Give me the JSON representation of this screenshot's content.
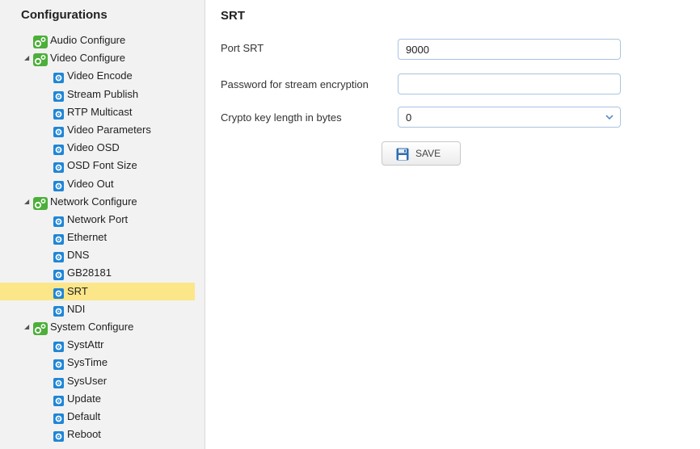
{
  "sidebar": {
    "title": "Configurations",
    "items": [
      {
        "level": 0,
        "label": "Audio Configure",
        "expandable": false,
        "icon": "gear-green-icon"
      },
      {
        "level": 0,
        "label": "Video Configure",
        "expandable": true,
        "icon": "gear-green-icon"
      },
      {
        "level": 1,
        "label": "Video Encode",
        "icon": "gear-blue-icon"
      },
      {
        "level": 1,
        "label": "Stream Publish",
        "icon": "gear-blue-icon"
      },
      {
        "level": 1,
        "label": "RTP Multicast",
        "icon": "gear-blue-icon"
      },
      {
        "level": 1,
        "label": "Video Parameters",
        "icon": "gear-blue-icon"
      },
      {
        "level": 1,
        "label": "Video OSD",
        "icon": "gear-blue-icon"
      },
      {
        "level": 1,
        "label": "OSD Font Size",
        "icon": "gear-blue-icon"
      },
      {
        "level": 1,
        "label": "Video Out",
        "icon": "gear-blue-icon"
      },
      {
        "level": 0,
        "label": "Network Configure",
        "expandable": true,
        "icon": "gear-green-icon"
      },
      {
        "level": 1,
        "label": "Network Port",
        "icon": "gear-blue-icon"
      },
      {
        "level": 1,
        "label": "Ethernet",
        "icon": "gear-blue-icon"
      },
      {
        "level": 1,
        "label": "DNS",
        "icon": "gear-blue-icon"
      },
      {
        "level": 1,
        "label": "GB28181",
        "icon": "gear-blue-icon"
      },
      {
        "level": 1,
        "label": "SRT",
        "icon": "gear-blue-icon",
        "selected": true
      },
      {
        "level": 1,
        "label": "NDI",
        "icon": "gear-blue-icon"
      },
      {
        "level": 0,
        "label": "System Configure",
        "expandable": true,
        "icon": "gear-green-icon"
      },
      {
        "level": 1,
        "label": "SystAttr",
        "icon": "gear-blue-icon"
      },
      {
        "level": 1,
        "label": "SysTime",
        "icon": "gear-blue-icon"
      },
      {
        "level": 1,
        "label": "SysUser",
        "icon": "gear-blue-icon"
      },
      {
        "level": 1,
        "label": "Update",
        "icon": "gear-blue-icon"
      },
      {
        "level": 1,
        "label": "Default",
        "icon": "gear-blue-icon"
      },
      {
        "level": 1,
        "label": "Reboot",
        "icon": "gear-blue-icon"
      }
    ]
  },
  "main": {
    "title": "SRT",
    "fields": {
      "port": {
        "label": "Port SRT",
        "value": "9000"
      },
      "password": {
        "label": "Password for stream encryption",
        "value": ""
      },
      "crypto": {
        "label": "Crypto key length in bytes",
        "value": "0"
      }
    },
    "save_label": "SAVE"
  },
  "colors": {
    "selected_bg": "#fce68a",
    "sidebar_bg": "#f2f2f2",
    "green_icon": "#4caf3a",
    "blue_icon": "#1f86d6",
    "input_border": "#a9c4e2"
  }
}
